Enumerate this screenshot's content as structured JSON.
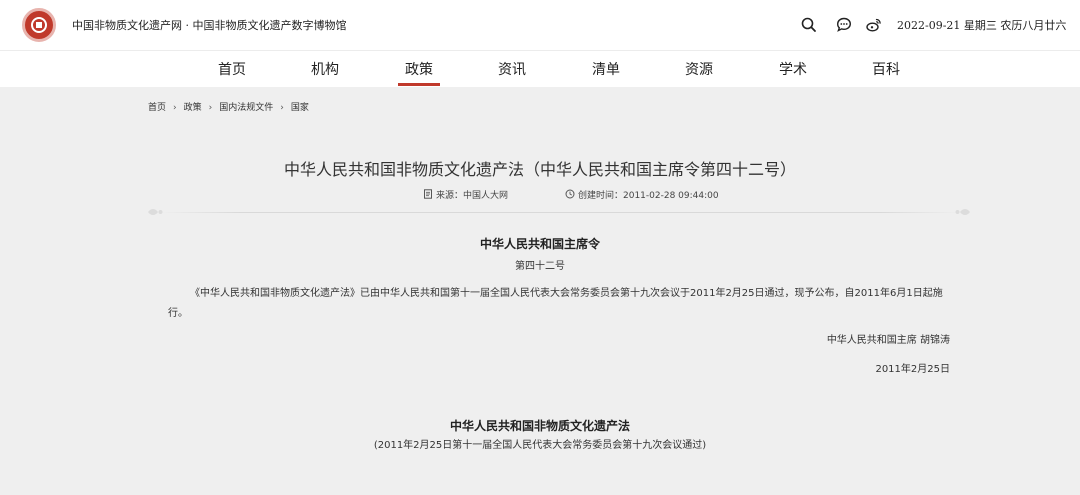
{
  "header": {
    "site_title": "中国非物质文化遗产网 · 中国非物质文化遗产数字博物馆",
    "date_text": "2022-09-21  星期三  农历八月廿六",
    "icons": [
      "search-icon",
      "chat-icon",
      "weibo-icon"
    ]
  },
  "nav": {
    "items": [
      "首页",
      "机构",
      "政策",
      "资讯",
      "清单",
      "资源",
      "学术",
      "百科"
    ],
    "active": "政策"
  },
  "breadcrumb": [
    "首页",
    "政策",
    "国内法规文件",
    "国家"
  ],
  "article": {
    "title": "中华人民共和国非物质文化遗产法（中华人民共和国主席令第四十二号）",
    "source": "来源：中国人大网",
    "created": "创建时间：2011-02-28 09:44:00",
    "decree_title": "中华人民共和国主席令",
    "decree_number": "第四十二号",
    "paragraph": "《中华人民共和国非物质文化遗产法》已由中华人民共和国第十一届全国人民代表大会常务委员会第十九次会议于2011年2月25日通过，现予公布，自2011年6月1日起施行。",
    "signature": "中华人民共和国主席 胡锦涛",
    "sign_date": "2011年2月25日",
    "law_title": "中华人民共和国非物质文化遗产法",
    "law_subtitle": "(2011年2月25日第十一届全国人民代表大会常务委员会第十九次会议通过)"
  },
  "colors": {
    "accent": "#c0392b",
    "background": "#efefef"
  }
}
